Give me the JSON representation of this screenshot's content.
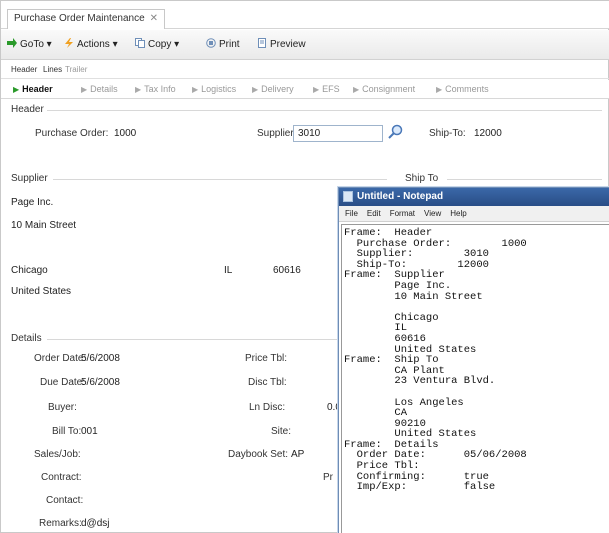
{
  "window": {
    "tab_title": "Purchase Order Maintenance",
    "close": "✕"
  },
  "toolbar": {
    "goto": "GoTo ▾",
    "actions": "Actions ▾",
    "copy": "Copy ▾",
    "print": "Print",
    "preview": "Preview"
  },
  "subtabs": [
    "Header",
    "Lines",
    "Trailer"
  ],
  "frame_nav": [
    "Header",
    "Details",
    "Tax Info",
    "Logistics",
    "Delivery",
    "EFS",
    "Consignment",
    "Comments"
  ],
  "header": {
    "section": "Header",
    "po_label": "Purchase Order:",
    "po_value": "1000",
    "supplier_label": "Supplier:",
    "supplier_value": "3010",
    "shipto_label": "Ship-To:",
    "shipto_value": "12000"
  },
  "supplier": {
    "section": "Supplier",
    "name": "Page Inc.",
    "street": "10 Main Street",
    "city": "Chicago",
    "state": "IL",
    "zip": "60616",
    "country": "United States"
  },
  "shipto": {
    "section": "Ship To"
  },
  "details": {
    "section": "Details",
    "order_date_label": "Order Date:",
    "order_date": "5/6/2008",
    "due_date_label": "Due Date:",
    "due_date": "5/6/2008",
    "buyer_label": "Buyer:",
    "bill_to_label": "Bill To:",
    "bill_to": "001",
    "sales_job_label": "Sales/Job:",
    "contract_label": "Contract:",
    "contact_label": "Contact:",
    "remarks_label": "Remarks:",
    "remarks": "d@dsj",
    "price_tbl_label": "Price Tbl:",
    "disc_tbl_label": "Disc Tbl:",
    "ln_disc_label": "Ln Disc:",
    "ln_disc_value": "0.0",
    "site_label": "Site:",
    "daybook_label": "Daybook Set:",
    "daybook_value": "AP",
    "pr_label": "Pr"
  },
  "notepad": {
    "title": "Untitled - Notepad",
    "menu": [
      "File",
      "Edit",
      "Format",
      "View",
      "Help"
    ],
    "text": "Frame:  Header\n  Purchase Order:        1000\n  Supplier:        3010\n  Ship-To:        12000\nFrame:  Supplier\n        Page Inc.\n        10 Main Street\n\n        Chicago\n        IL\n        60616\n        United States\nFrame:  Ship To\n        CA Plant\n        23 Ventura Blvd.\n\n        Los Angeles\n        CA\n        90210\n        United States\nFrame:  Details\n  Order Date:      05/06/2008\n  Price Tbl:\n  Confirming:      true\n  Imp/Exp:         false"
  },
  "colors": {
    "accent": "#2a9a2a",
    "notepad_title": "#2f5a98"
  }
}
